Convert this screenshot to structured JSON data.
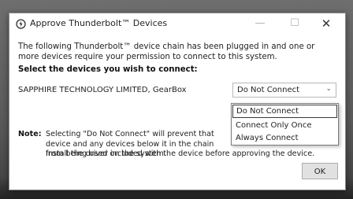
{
  "window": {
    "title": "Approve Thunderbolt™ Devices",
    "minimize_glyph": "—",
    "maximize_glyph": "☐",
    "close_glyph": "✕"
  },
  "description": "The following Thunderbolt™ device chain has been plugged in and one or more devices require your permission to connect to this system.",
  "select_heading": "Select the devices you wish to connect:",
  "device": {
    "name": "SAPPHIRE TECHNOLOGY LIMITED, GearBox",
    "selected_option": "Do Not Connect",
    "options": [
      "Do Not Connect",
      "Connect Only Once",
      "Always Connect"
    ]
  },
  "note": {
    "label": "Note:",
    "text": "Selecting \"Do Not Connect\" will prevent that device and any devices below it in the chain from being used on the system.",
    "line3": "Install the driver included with the device before approving the device."
  },
  "ok_label": "OK",
  "icons": {
    "title_icon": "thunderbolt-icon",
    "dropdown_arrow": "chevron-down-icon"
  }
}
